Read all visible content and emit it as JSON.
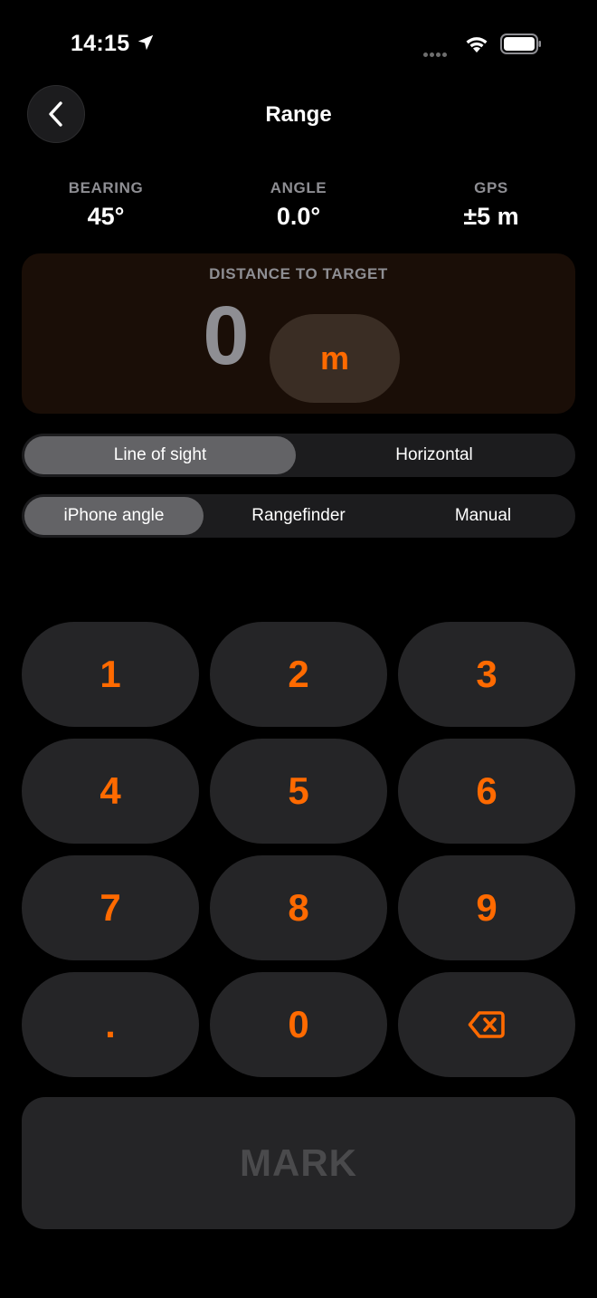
{
  "status_bar": {
    "time": "14:15"
  },
  "header": {
    "title": "Range"
  },
  "stats": [
    {
      "label": "BEARING",
      "value": "45°"
    },
    {
      "label": "ANGLE",
      "value": "0.0°"
    },
    {
      "label": "GPS",
      "value": "±5 m"
    }
  ],
  "distance": {
    "label": "DISTANCE TO TARGET",
    "value": "0",
    "unit": "m"
  },
  "mode_segment": {
    "options": [
      "Line of sight",
      "Horizontal"
    ],
    "selected": "Line of sight"
  },
  "source_segment": {
    "options": [
      "iPhone angle",
      "Rangefinder",
      "Manual"
    ],
    "selected": "iPhone angle"
  },
  "keypad": {
    "keys": [
      "1",
      "2",
      "3",
      "4",
      "5",
      "6",
      "7",
      "8",
      "9",
      ".",
      "0"
    ],
    "delete_icon": "delete-left-icon"
  },
  "mark_button": {
    "label": "MARK"
  },
  "colors": {
    "accent": "#ff6a00",
    "background": "#000000",
    "key": "#252527",
    "muted": "#8e8e93"
  }
}
